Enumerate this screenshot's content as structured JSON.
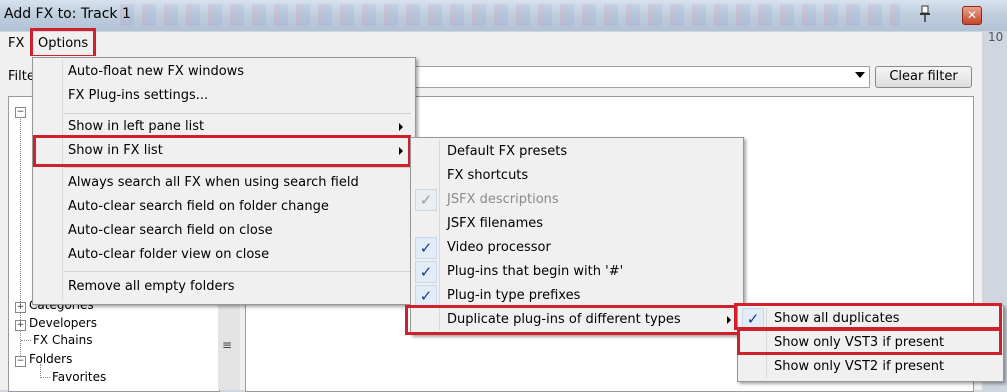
{
  "window": {
    "title": "Add FX to: Track 1",
    "bg_tick": "10"
  },
  "menubar": {
    "fx": "FX",
    "options": "Options"
  },
  "filter": {
    "label": "Filte",
    "value": "",
    "clear_button": "Clear filter"
  },
  "left_tree": {
    "items": [
      "Categories",
      "Developers",
      "FX Chains",
      "Folders",
      "Favorites"
    ]
  },
  "options_menu": {
    "items": [
      "Auto-float new FX windows",
      "FX Plug-ins settings...",
      "Show in left pane list",
      "Show in FX list",
      "Always search all FX when using search field",
      "Auto-clear search field on folder change",
      "Auto-clear search field on close",
      "Auto-clear folder view on close",
      "Remove all empty folders"
    ]
  },
  "fx_list_submenu": {
    "items": [
      "Default FX presets",
      "FX shortcuts",
      "JSFX descriptions",
      "JSFX filenames",
      "Video processor",
      "Plug-ins that begin with '#'",
      "Plug-in type prefixes",
      "Duplicate plug-ins of different types"
    ],
    "checked": [
      false,
      false,
      true,
      false,
      true,
      true,
      true,
      false
    ],
    "disabled": [
      false,
      false,
      true,
      false,
      false,
      false,
      false,
      false
    ]
  },
  "duplicates_submenu": {
    "items": [
      "Show all duplicates",
      "Show only VST3 if present",
      "Show only VST2 if present"
    ],
    "checked": [
      true,
      false,
      false
    ]
  },
  "colors": {
    "highlight_border": "#d0202c",
    "check_color": "#1a3a8a"
  }
}
